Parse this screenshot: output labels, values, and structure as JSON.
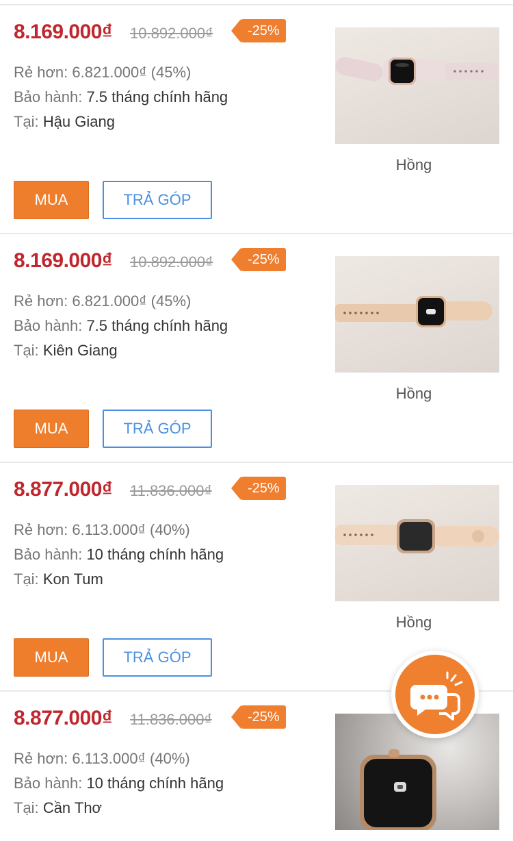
{
  "colors": {
    "price": "#c0262d",
    "badge": "#ef7e2f",
    "buy_button": "#ee7d2c",
    "install_button": "#4a90e2",
    "chat_fab": "#ef8030"
  },
  "labels": {
    "cheaper": "Rẻ hơn:",
    "warranty": "Bảo hành:",
    "location": "Tại:"
  },
  "listings": [
    {
      "price": "8.169.000₫",
      "old_price": "10.892.000₫",
      "discount": "-25%",
      "savings": "6.821.000₫ (45%)",
      "warranty": "7.5 tháng chính hãng",
      "location": "Hậu Giang",
      "color": "Hồng",
      "buy_label": "MUA",
      "installment_label": "TRẢ GÓP"
    },
    {
      "price": "8.169.000₫",
      "old_price": "10.892.000₫",
      "discount": "-25%",
      "savings": "6.821.000₫ (45%)",
      "warranty": "7.5 tháng chính hãng",
      "location": "Kiên Giang",
      "color": "Hồng",
      "buy_label": "MUA",
      "installment_label": "TRẢ GÓP"
    },
    {
      "price": "8.877.000₫",
      "old_price": "11.836.000₫",
      "discount": "-25%",
      "savings": "6.113.000₫ (40%)",
      "warranty": "10 tháng chính hãng",
      "location": "Kon Tum",
      "color": "Hồng",
      "buy_label": "MUA",
      "installment_label": "TRẢ GÓP"
    },
    {
      "price": "8.877.000₫",
      "old_price": "11.836.000₫",
      "discount": "-25%",
      "savings": "6.113.000₫ (40%)",
      "warranty": "10 tháng chính hãng",
      "location": "Cần Thơ"
    }
  ],
  "chat": {
    "icon": "chat-bubbles-icon"
  }
}
